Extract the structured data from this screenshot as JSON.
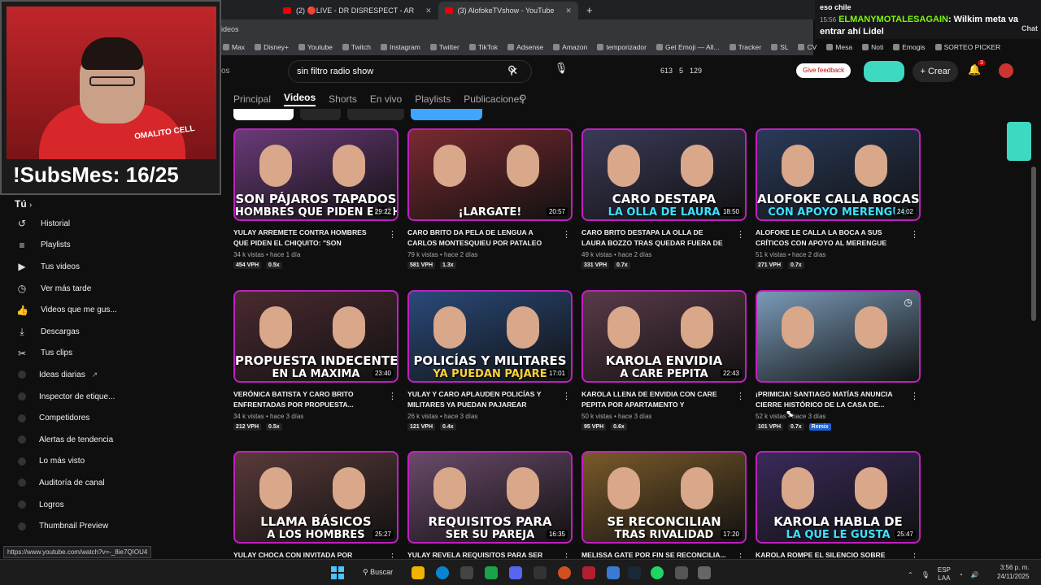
{
  "browser": {
    "tabs": [
      {
        "label": "(2) 🔴LIVE - DR DISRESPECT - AR"
      },
      {
        "label": "(3) AlofokeTVshow - YouTube",
        "active": true
      }
    ],
    "new_tab": "+",
    "addr_fragment": "ideos",
    "bookmarks": [
      "Max",
      "Disney+",
      "Youtube",
      "Twitch",
      "Instagram",
      "Twitter",
      "TikTok",
      "Adsense",
      "Amazon",
      "temporizador",
      "Get Emoji — All...",
      "Tracker",
      "SL",
      "CV",
      "Mesa",
      "Noti",
      "Emogis",
      "SORTEO PICKER"
    ]
  },
  "chat_overlay": {
    "top_text": "eso chile",
    "time": "15:56",
    "user": "ELMANYMOTALESAGAIN",
    "message": ": Wilkim meta va entrar ahí Lidel",
    "chat_label": "Chat"
  },
  "webcam": {
    "brand": "OMALITO CELL",
    "subs_label": "!SubsMes: 16/25"
  },
  "header": {
    "left_fragment": "os",
    "search_value": "sin filtro radio show",
    "stats": [
      "613",
      "5",
      "129"
    ],
    "feedback": "Give feedback",
    "create": "Crear",
    "notif_count": "3"
  },
  "channel_tabs": [
    {
      "label": "Principal"
    },
    {
      "label": "Videos",
      "selected": true
    },
    {
      "label": "Shorts"
    },
    {
      "label": "En vivo"
    },
    {
      "label": "Playlists"
    },
    {
      "label": "Publicaciones"
    }
  ],
  "sidebar": {
    "heading": "Tú",
    "items": [
      {
        "label": "Historial",
        "icon": "history-icon",
        "glyph": "↺"
      },
      {
        "label": "Playlists",
        "icon": "playlists-icon",
        "glyph": "≡"
      },
      {
        "label": "Tus videos",
        "icon": "your-videos-icon",
        "glyph": "▶"
      },
      {
        "label": "Ver más tarde",
        "icon": "watch-later-icon",
        "glyph": "◷"
      },
      {
        "label": "Videos que me gus...",
        "icon": "liked-icon",
        "glyph": "👍"
      },
      {
        "label": "Descargas",
        "icon": "download-icon",
        "glyph": "⤓"
      },
      {
        "label": "Tus clips",
        "icon": "clips-icon",
        "glyph": "✂"
      },
      {
        "label": "Ideas diarias",
        "icon": "ext-icon",
        "glyph": "",
        "ext": "↗"
      },
      {
        "label": "Inspector de etique...",
        "icon": "ext-icon",
        "glyph": ""
      },
      {
        "label": "Competidores",
        "icon": "ext-icon",
        "glyph": ""
      },
      {
        "label": "Alertas de tendencia",
        "icon": "ext-icon",
        "glyph": ""
      },
      {
        "label": "Lo más visto",
        "icon": "ext-icon",
        "glyph": ""
      },
      {
        "label": "Auditoría de canal",
        "icon": "ext-icon",
        "glyph": ""
      },
      {
        "label": "Logros",
        "icon": "ext-icon",
        "glyph": ""
      },
      {
        "label": "Thumbnail Preview",
        "icon": "ext-icon",
        "glyph": ""
      }
    ]
  },
  "videos": [
    {
      "thumb_line1": "SON PÁJAROS TAPADOS",
      "thumb_line2": "HOMBRES QUE PIDEN EL CHIQUITO",
      "line2_color": "#ffffff",
      "bg": "#6a3a78",
      "duration": "29:22",
      "title": "YULAY ARREMETE CONTRA HOMBRES QUE PIDEN EL CHIQUITO: \"SON PÁJAROS...",
      "views": "34 k vistas",
      "age": "hace 1 día",
      "vph": "454 VPH",
      "ratio": "0.5x"
    },
    {
      "thumb_line1": "",
      "thumb_line2": "¡LARGATE!",
      "line2_color": "#ffffff",
      "bg": "#7a2a30",
      "duration": "20:57",
      "title": "CARO BRITO DA PELA DE LENGUA A CARLOS MONTESQUIEU POR PATALEO EN...",
      "views": "79 k vistas",
      "age": "hace 2 días",
      "vph": "581 VPH",
      "ratio": "1.3x"
    },
    {
      "thumb_line1": "CARO DESTAPA",
      "thumb_line2": "LA OLLA DE LAURA",
      "line2_color": "#3ee0ff",
      "bg": "#3a3a58",
      "duration": "18:50",
      "title": "CARO BRITO DESTAPA LA OLLA DE LAURA BOZZO TRAS QUEDAR FUERA DE CASA...",
      "views": "49 k vistas",
      "age": "hace 2 días",
      "vph": "331 VPH",
      "ratio": "0.7x"
    },
    {
      "thumb_line1": "ALOFOKE CALLA BOCAS",
      "thumb_line2": "CON APOYO MERENGUE",
      "line2_color": "#3ee0ff",
      "bg": "#2a3a5a",
      "duration": "24:02",
      "title": "ALOFOKE LE CALLA LA BOCA A SUS CRÍTICOS CON APOYO AL MERENGUE EN...",
      "views": "51 k vistas",
      "age": "hace 2 días",
      "vph": "271 VPH",
      "ratio": "0.7x"
    },
    {
      "thumb_line1": "PROPUESTA INDECENTE",
      "thumb_line2": "EN LA MAXIMA",
      "line2_color": "#ffffff",
      "bg": "#4a2a30",
      "duration": "23:40",
      "title": "VERÓNICA BATISTA Y CARO BRITO ENFRENTADAS POR PROPUESTA...",
      "views": "34 k vistas",
      "age": "hace 3 días",
      "vph": "212 VPH",
      "ratio": "0.5x"
    },
    {
      "thumb_line1": "POLICÍAS Y MILITARES",
      "thumb_line2": "YA PUEDAN PAJARE",
      "line2_color": "#ffd23a",
      "bg": "#2a4a7a",
      "duration": "17:01",
      "title": "YULAY Y CARO APLAUDEN POLICÍAS Y MILITARES YA PUEDAN PAJAREAR",
      "views": "26 k vistas",
      "age": "hace 3 días",
      "vph": "121 VPH",
      "ratio": "0.4x"
    },
    {
      "thumb_line1": "KAROLA ENVIDIA",
      "thumb_line2": "A CARE PEPITA",
      "line2_color": "#ffffff",
      "bg": "#5a3a4a",
      "duration": "22:43",
      "title": "KAROLA LLENA DE ENVIDIA CON CARE PEPITA POR APARTAMENTO Y DISPUESTA...",
      "views": "50 k vistas",
      "age": "hace 3 días",
      "vph": "95 VPH",
      "ratio": "0.6x"
    },
    {
      "thumb_line1": "",
      "thumb_line2": "",
      "line2_color": "#ffffff",
      "bg": "#7a9ab8",
      "duration": "",
      "title": "¡PRIMICIA! SANTIAGO MATÍAS ANUNCIA CIERRE HISTÓRICO DE LA CASA DE...",
      "views": "52 k vistas",
      "age": "hace 3 días",
      "vph": "101 VPH",
      "ratio": "0.7x",
      "remix": "Remix",
      "clock": true
    },
    {
      "thumb_line1": "LLAMA BÁSICOS",
      "thumb_line2": "A LOS HOMBRES",
      "line2_color": "#ffffff",
      "bg": "#5a3a3a",
      "duration": "25:27",
      "title": "YULAY CHOCA CON INVITADA POR LLAMAR...",
      "views": "",
      "age": "",
      "vph": "",
      "ratio": ""
    },
    {
      "thumb_line1": "REQUISITOS PARA",
      "thumb_line2": "SER SU PAREJA",
      "line2_color": "#ffffff",
      "bg": "#6a4a6a",
      "duration": "16:35",
      "title": "YULAY REVELA REQUISITOS PARA SER SU...",
      "views": "",
      "age": "",
      "vph": "",
      "ratio": ""
    },
    {
      "thumb_line1": "SE RECONCILIAN",
      "thumb_line2": "TRAS RIVALIDAD",
      "line2_color": "#ffffff",
      "bg": "#7a5a2a",
      "duration": "17:20",
      "title": "MELISSA GATE POR FIN SE RECONCILIA...",
      "views": "",
      "age": "",
      "vph": "",
      "ratio": ""
    },
    {
      "thumb_line1": "KAROLA HABLA DE",
      "thumb_line2": "LA QUE LE GUSTA",
      "line2_color": "#3ee0ff",
      "bg": "#3a2a5a",
      "duration": "25:47",
      "title": "KAROLA ROMPE EL SILENCIO SOBRE LA...",
      "views": "",
      "age": "",
      "vph": "",
      "ratio": ""
    }
  ],
  "status_url": "https://www.youtube.com/watch?v=-_8ie7QIOU4",
  "taskbar": {
    "search": "Buscar",
    "lang_top": "ESP",
    "lang_bottom": "LAA",
    "time": "3:56 p. m.",
    "date": "24/11/2025"
  }
}
